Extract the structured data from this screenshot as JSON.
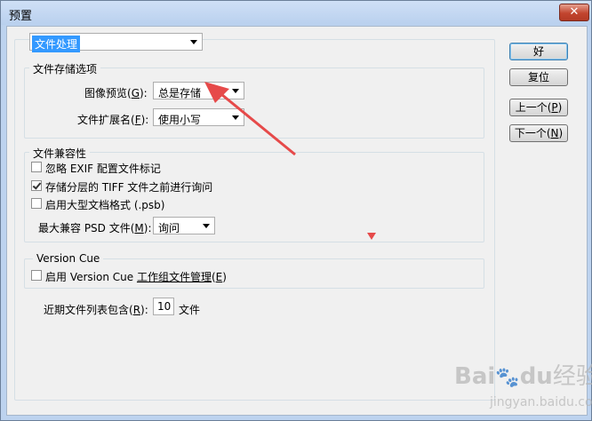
{
  "window": {
    "title": "预置",
    "close_glyph": "✕"
  },
  "section_select": {
    "value": "文件处理"
  },
  "file_save_group": {
    "label": "文件存储选项",
    "image_preview": {
      "label_prefix": "图像预览(",
      "mnemonic": "G",
      "label_suffix": "):",
      "value": "总是存储"
    },
    "file_extension": {
      "label_prefix": "文件扩展名(",
      "mnemonic": "F",
      "label_suffix": "):",
      "value": "使用小写"
    }
  },
  "compat_group": {
    "label": "文件兼容性",
    "checkboxes": [
      {
        "label": "忽略 EXIF 配置文件标记",
        "checked": false
      },
      {
        "label": "存储分层的 TIFF 文件之前进行询问",
        "checked": true
      },
      {
        "label": "启用大型文档格式 (.psb)",
        "checked": false
      }
    ],
    "max_psd": {
      "label_prefix": "最大兼容 PSD 文件(",
      "mnemonic": "M",
      "label_suffix": "):",
      "value": "询问"
    }
  },
  "version_cue_group": {
    "label": "Version Cue",
    "checkbox": {
      "label_prefix": "启用 Version Cue ",
      "label_underlined": "工作组文件管理",
      "label_mn_open": "(",
      "mnemonic": "E",
      "label_mn_close": ")",
      "checked": false
    }
  },
  "recent_files": {
    "label_prefix": "近期文件列表包含(",
    "mnemonic": "R",
    "label_suffix": "):",
    "value": "10",
    "unit": "文件"
  },
  "buttons": {
    "ok": "好",
    "reset": "复位",
    "prev": {
      "prefix": "上一个(",
      "mnemonic": "P",
      "suffix": ")"
    },
    "next": {
      "prefix": "下一个(",
      "mnemonic": "N",
      "suffix": ")"
    }
  },
  "watermark": {
    "brand": "Bai",
    "mid": "du",
    "suffix": "经验",
    "url": "jingyan.baidu.com"
  },
  "colors": {
    "annotation": "#e64a4a",
    "selection": "#3399ff",
    "title_bar": "#bdd3ef"
  }
}
